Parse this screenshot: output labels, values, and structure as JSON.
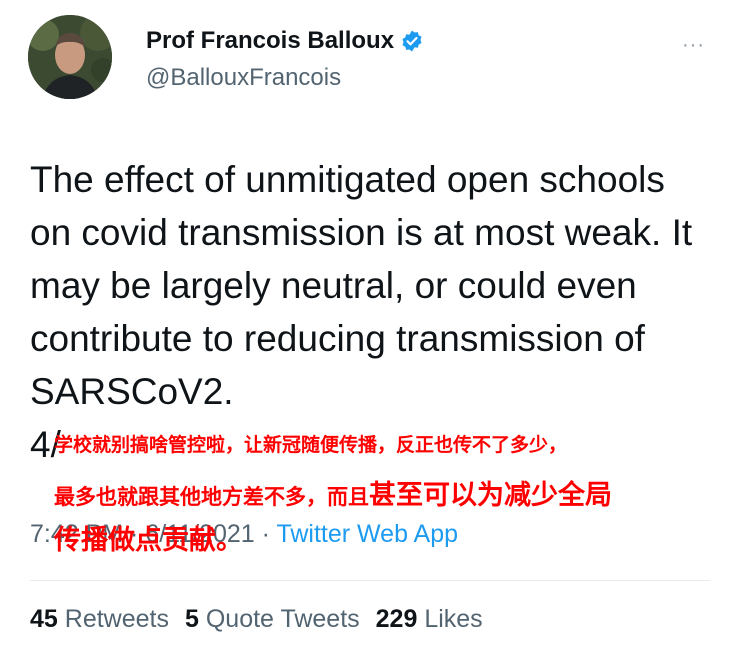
{
  "author": {
    "display_name": "Prof Francois Balloux",
    "handle": "@BallouxFrancois",
    "verified_icon": "verified-badge-icon",
    "avatar_icon": "profile-photo"
  },
  "more_menu": "···",
  "tweet": {
    "text": "The effect of unmitigated open schools on covid transmission is at most weak. It may be largely neutral, or could even contribute to reducing transmission of SARSCoV2.\n4/"
  },
  "meta": {
    "time_date": "7:42 PM · 6/11/2021",
    "separator": " · ",
    "source": "Twitter Web App"
  },
  "stats": {
    "retweets_count": "45",
    "retweets_label": "Retweets",
    "quotes_count": "5",
    "quotes_label": "Quote Tweets",
    "likes_count": "229",
    "likes_label": "Likes"
  },
  "overlay": {
    "line1": "学校就别搞啥管控啦，让新冠随便传播，反正也传不了多少，",
    "line2_small": "最多也就跟其他地方差不多，而且",
    "line2_big": "甚至可以为减少全局",
    "line3": "传播做点贡献。"
  },
  "colors": {
    "text": "#0f1419",
    "secondary": "#536471",
    "link": "#1d9bf0",
    "verified": "#1d9bf0",
    "overlay": "#ff0000"
  }
}
